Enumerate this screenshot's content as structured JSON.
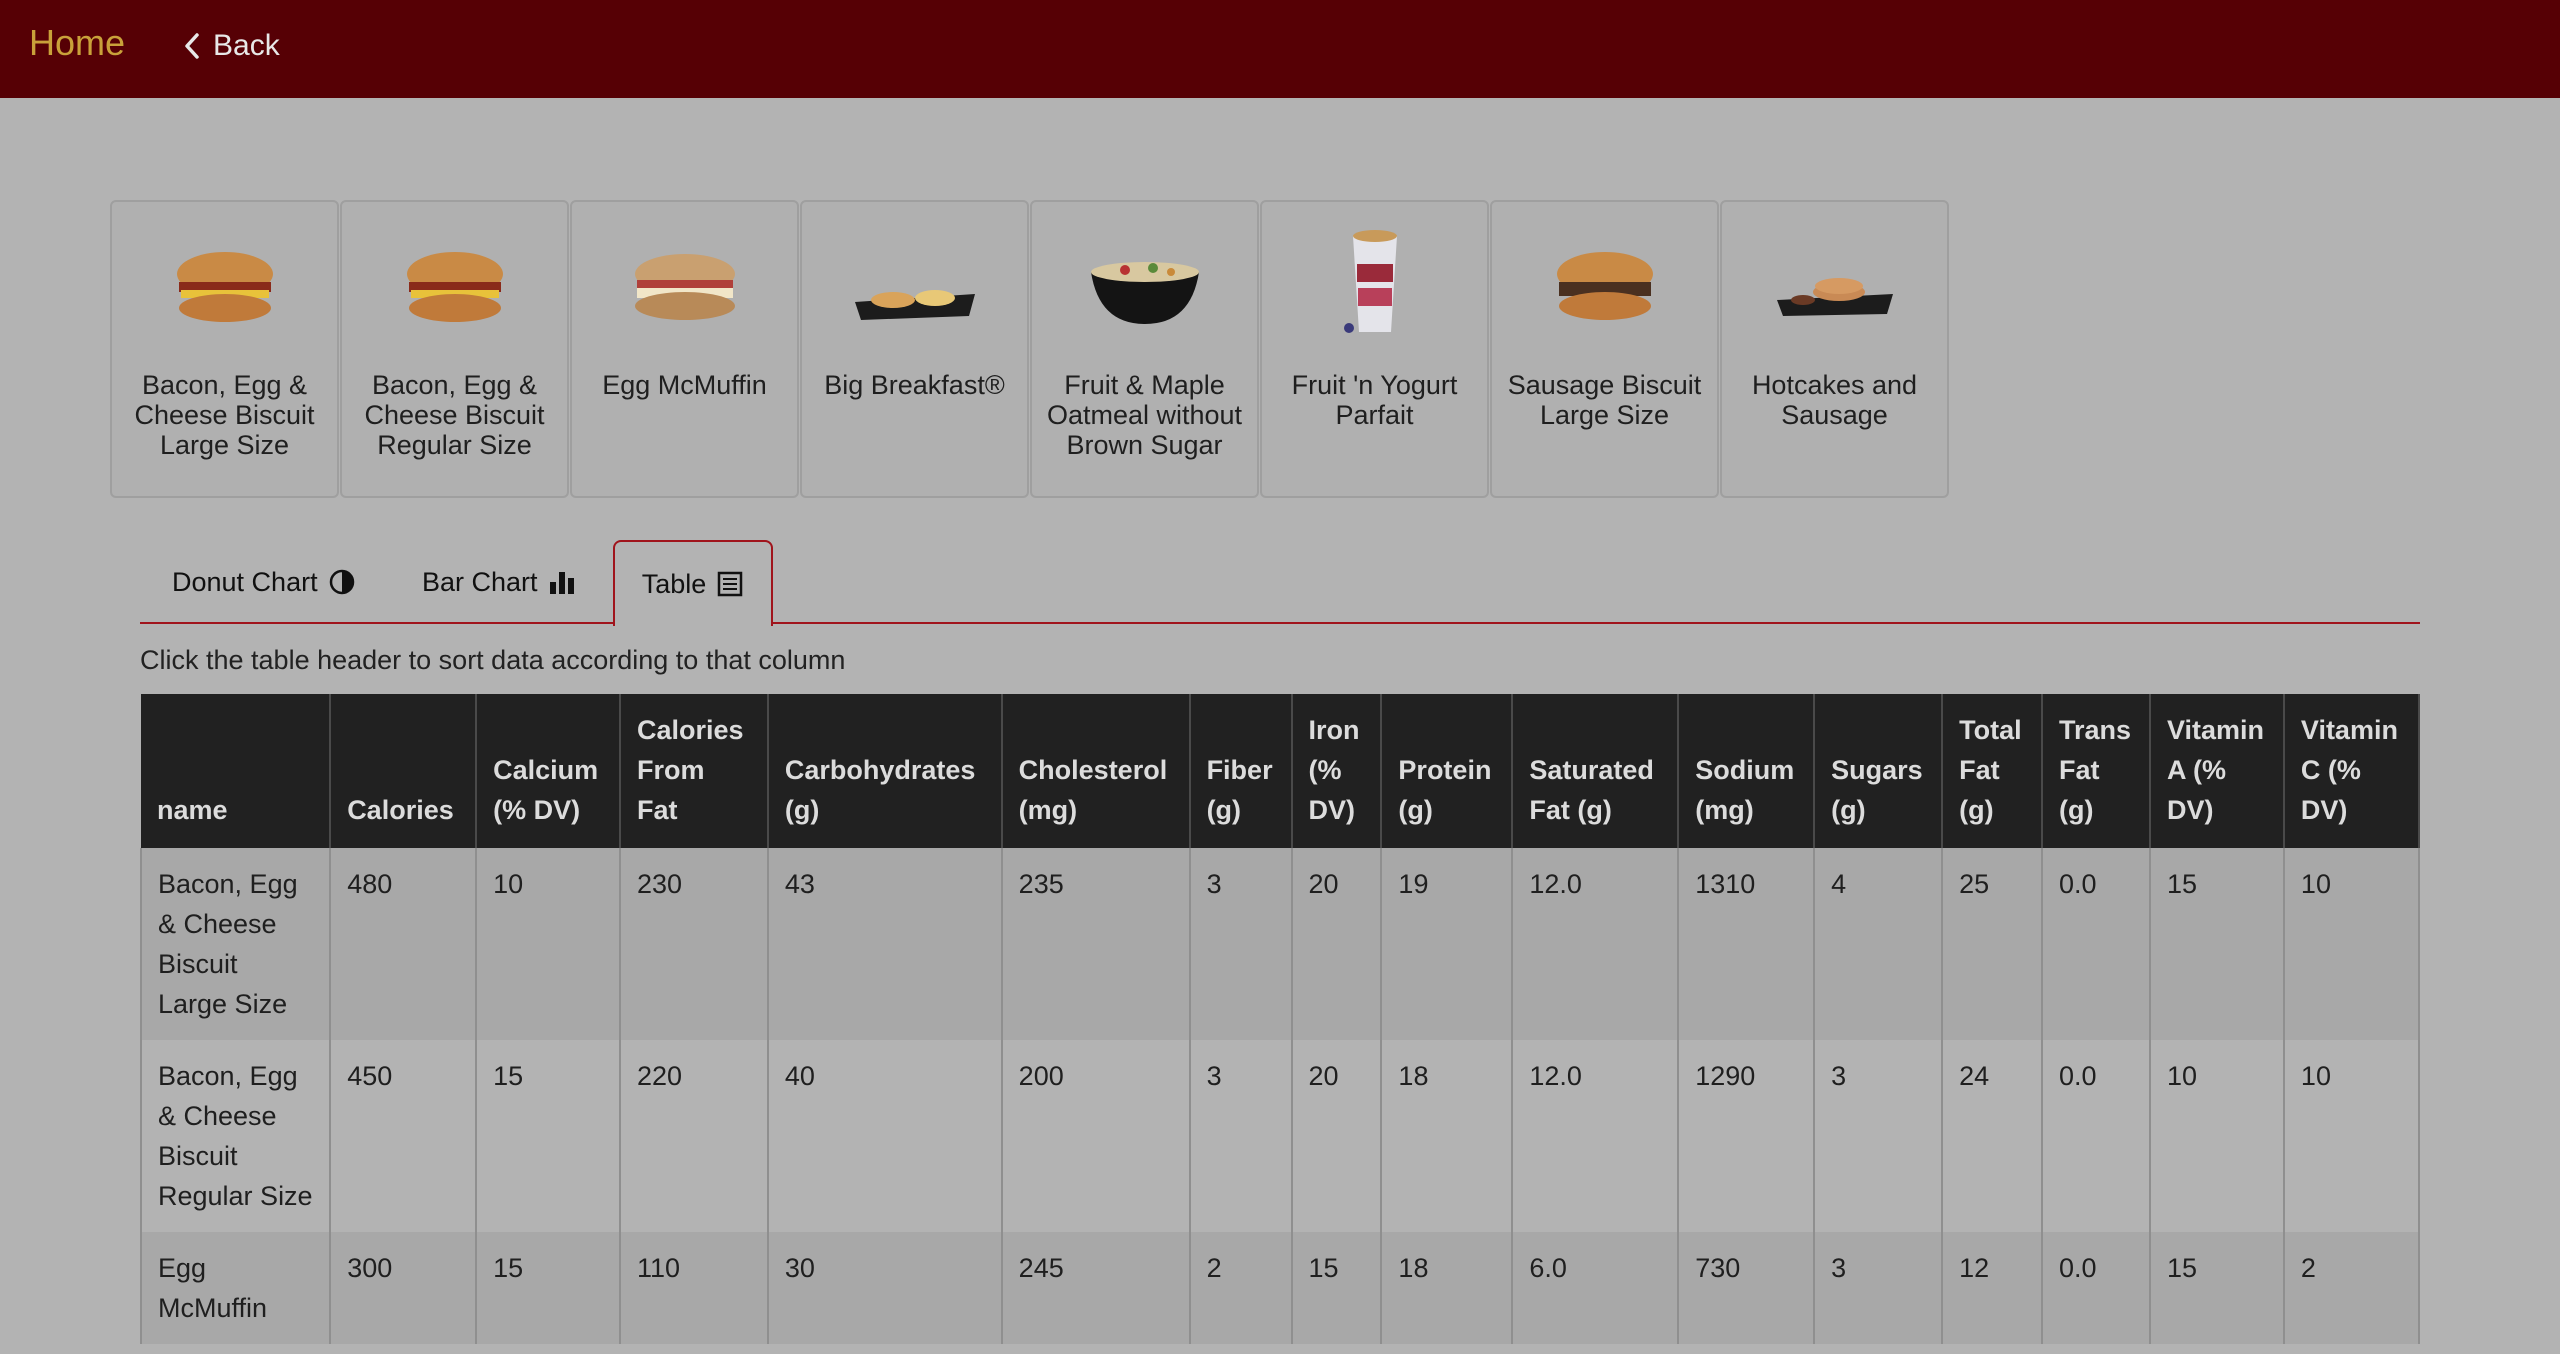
{
  "nav": {
    "home": "Home",
    "back": "Back"
  },
  "products": [
    {
      "label": "Bacon, Egg & Cheese Biscuit Large Size",
      "icon": "biscuit-sandwich-image"
    },
    {
      "label": "Bacon, Egg & Cheese Biscuit Regular Size",
      "icon": "biscuit-sandwich-image"
    },
    {
      "label": "Egg McMuffin",
      "icon": "muffin-sandwich-image"
    },
    {
      "label": "Big Breakfast®",
      "icon": "breakfast-platter-image"
    },
    {
      "label": "Fruit & Maple Oatmeal without Brown Sugar",
      "icon": "oatmeal-bowl-image"
    },
    {
      "label": "Fruit 'n Yogurt Parfait",
      "icon": "parfait-cup-image"
    },
    {
      "label": "Sausage Biscuit Large Size",
      "icon": "sausage-biscuit-image"
    },
    {
      "label": "Hotcakes and Sausage",
      "icon": "hotcakes-platter-image"
    }
  ],
  "tabs": {
    "donut": "Donut Chart",
    "bar": "Bar Chart",
    "table": "Table",
    "active": "Table"
  },
  "hint": "Click the table header to sort data according to that column",
  "table": {
    "headers": [
      "name",
      "Calories",
      "Calcium (% DV)",
      "Calories From Fat",
      "Carbohydrates (g)",
      "Cholesterol (mg)",
      "Fiber (g)",
      "Iron (% DV)",
      "Protein (g)",
      "Saturated Fat (g)",
      "Sodium (mg)",
      "Sugars (g)",
      "Total Fat (g)",
      "Trans Fat (g)",
      "Vitamin A (% DV)",
      "Vitamin C (% DV)"
    ],
    "rows": [
      [
        "Bacon, Egg & Cheese Biscuit Large Size",
        "480",
        "10",
        "230",
        "43",
        "235",
        "3",
        "20",
        "19",
        "12.0",
        "1310",
        "4",
        "25",
        "0.0",
        "15",
        "10"
      ],
      [
        "Bacon, Egg & Cheese Biscuit Regular Size",
        "450",
        "15",
        "220",
        "40",
        "200",
        "3",
        "20",
        "18",
        "12.0",
        "1290",
        "3",
        "24",
        "0.0",
        "10",
        "10"
      ],
      [
        "Egg McMuffin",
        "300",
        "15",
        "110",
        "30",
        "245",
        "2",
        "15",
        "18",
        "6.0",
        "730",
        "3",
        "12",
        "0.0",
        "15",
        "2"
      ]
    ]
  },
  "colors": {
    "topbar": "#560005",
    "home_link": "#c9a13a",
    "accent_border": "#a0141c",
    "table_header_bg": "#212121"
  }
}
